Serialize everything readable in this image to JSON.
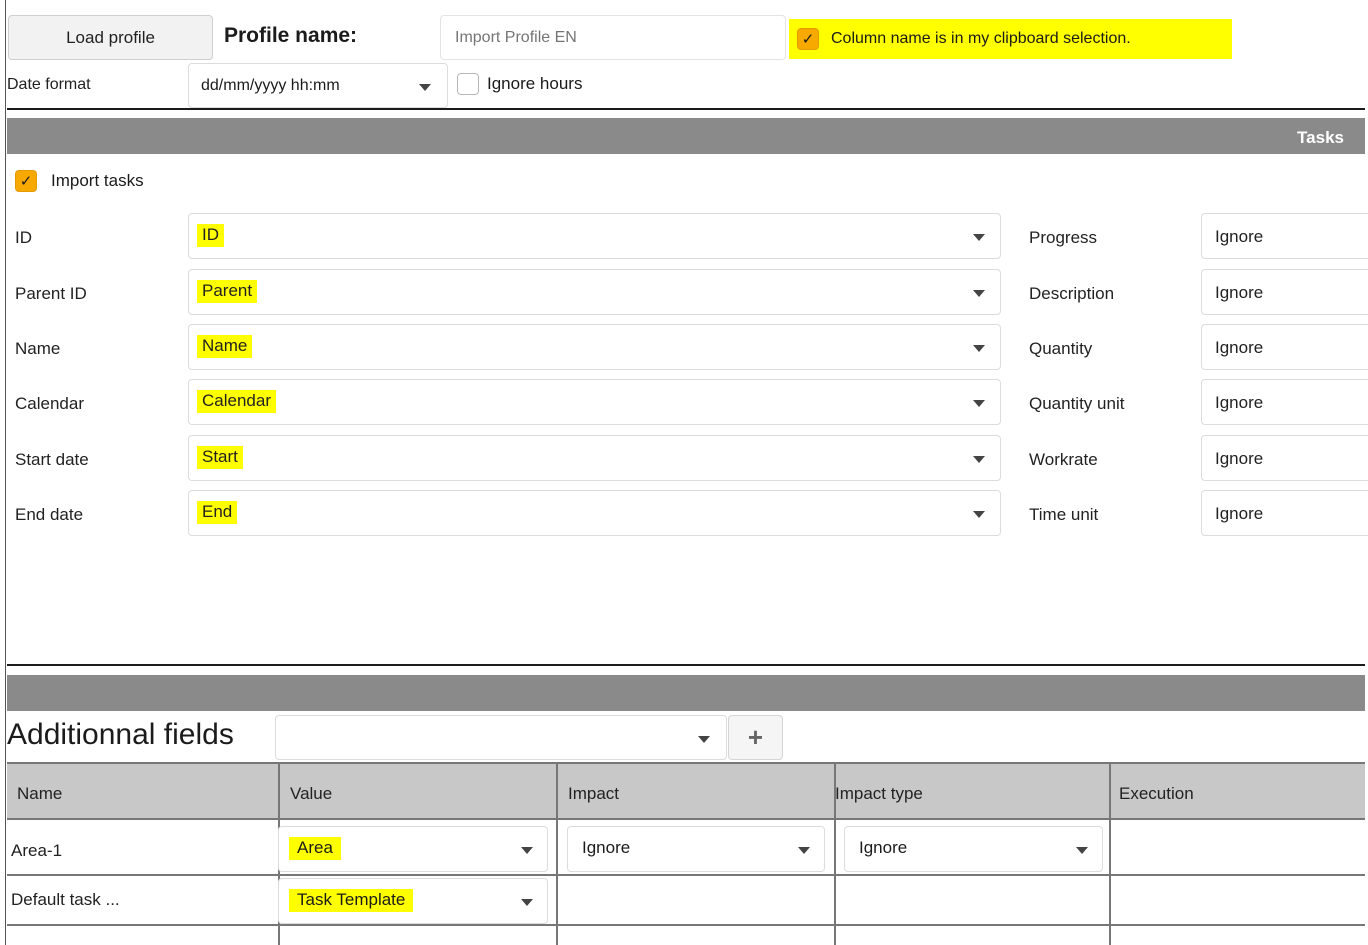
{
  "toolbar": {
    "load_label": "Load profile",
    "profile_name_label": "Profile name:",
    "profile_name_placeholder": "Import Profile EN",
    "column_name_check_label": "Column name is in my clipboard selection.",
    "column_name_checked": true,
    "date_format_label": "Date format",
    "date_format_value": "dd/mm/yyyy hh:mm",
    "ignore_hours_label": "Ignore hours",
    "ignore_hours_checked": false
  },
  "tasks": {
    "section_title": "Tasks",
    "import_label": "Import tasks",
    "import_checked": true,
    "left_fields": [
      {
        "label": "ID",
        "value": "ID"
      },
      {
        "label": "Parent ID",
        "value": "Parent"
      },
      {
        "label": "Name",
        "value": "Name"
      },
      {
        "label": "Calendar",
        "value": "Calendar"
      },
      {
        "label": "Start date",
        "value": "Start"
      },
      {
        "label": "End date",
        "value": "End"
      }
    ],
    "right_fields": [
      {
        "label": "Progress",
        "value": "Ignore"
      },
      {
        "label": "Description",
        "value": "Ignore"
      },
      {
        "label": "Quantity",
        "value": "Ignore"
      },
      {
        "label": "Quantity unit",
        "value": "Ignore"
      },
      {
        "label": "Workrate",
        "value": "Ignore"
      },
      {
        "label": "Time unit",
        "value": "Ignore"
      }
    ]
  },
  "additional": {
    "title": "Additionnal fields",
    "add_symbol": "+",
    "columns": [
      "Name",
      "Value",
      "Impact",
      "Impact type",
      "Execution"
    ],
    "rows": [
      {
        "name": "Area-1",
        "value": "Area",
        "impact": "Ignore",
        "impact_type": "Ignore"
      },
      {
        "name": "Default task ...",
        "value": "Task Template"
      }
    ]
  },
  "colors": {
    "highlight": "#ffff00",
    "check_accent": "#f7a900",
    "header_bar": "#8a8a8a",
    "grid_header": "#c8c8c8"
  }
}
